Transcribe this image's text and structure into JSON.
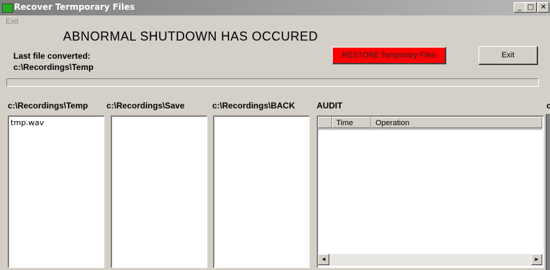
{
  "window": {
    "title": "Recover Termporary Files",
    "controls": {
      "minimize": "_",
      "maximize": "□",
      "close": "✕"
    }
  },
  "menu": {
    "exit": "Exit"
  },
  "headline": "ABNORMAL SHUTDOWN HAS OCCURED",
  "status": {
    "last_label": "Last file converted:",
    "last_path": "c:\\Recordings\\Temp"
  },
  "buttons": {
    "restore": "RESTORE Temporary Files",
    "exit": "Exit"
  },
  "colors": {
    "restore_bg": "#ff0000",
    "title_bar": "#7e7e7e"
  },
  "columns": {
    "temp": {
      "label": "c:\\Recordings\\Temp",
      "items": [
        "tmp.wav"
      ]
    },
    "save": {
      "label": "c:\\Recordings\\Save",
      "items": []
    },
    "back": {
      "label": "c:\\Recordings\\BACK",
      "items": []
    },
    "audit": {
      "label": "AUDIT",
      "headers": [
        "",
        "Time",
        "Operation"
      ]
    }
  },
  "icons": {
    "app": "app-icon",
    "scroll_left": "◄",
    "scroll_right": "►"
  },
  "edge_glyph": "c"
}
